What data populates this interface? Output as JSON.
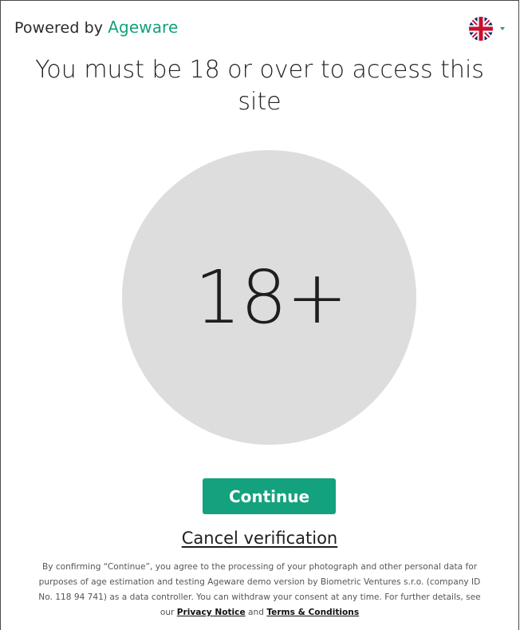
{
  "header": {
    "powered_by": "Powered by",
    "brand": "Ageware",
    "language_icon": "uk-flag-icon",
    "dropdown_icon": "chevron-down-icon"
  },
  "main": {
    "title": "You must be 18 or over to access this site",
    "age_badge": "18+"
  },
  "actions": {
    "continue_label": "Continue",
    "cancel_label": "Cancel verification"
  },
  "legal": {
    "text": "By confirming “Continue”, you agree to the processing of your photograph and other personal data for purposes of age estimation and testing Ageware demo version by Biometric Ventures s.r.o. (company ID No. 118 94 741) as a data controller. You can withdraw your consent at any time. For further details, see our",
    "privacy_link": "Privacy Notice",
    "and": "and",
    "terms_link": "Terms & Conditions"
  },
  "colors": {
    "brand_green": "#13a27d",
    "circle_grey": "#dddddd",
    "text_dark": "#1f1f1f"
  }
}
